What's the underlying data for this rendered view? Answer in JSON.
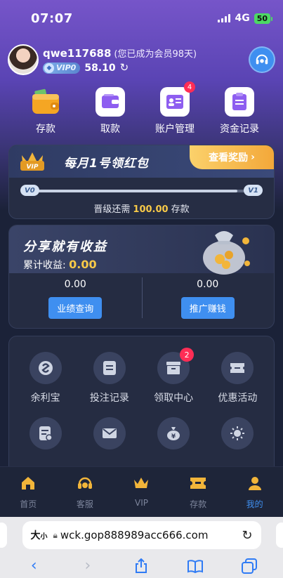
{
  "status_bar": {
    "time": "07:07",
    "network": "4G",
    "battery": "50"
  },
  "profile": {
    "username": "qwe117688",
    "member_note": "(您已成为会员98天)",
    "vip_level": "VIP0",
    "balance": "58.10"
  },
  "quick_actions": [
    {
      "label": "存款",
      "icon": "wallet-icon"
    },
    {
      "label": "取款",
      "icon": "withdraw-wallet-icon"
    },
    {
      "label": "账户管理",
      "icon": "id-card-icon",
      "badge": "4"
    },
    {
      "label": "资金记录",
      "icon": "records-icon"
    }
  ],
  "red_packet": {
    "title": "每月1号领红包",
    "cta": "查看奖励",
    "level_from": "V0",
    "level_to": "V1",
    "progress": 0.92,
    "upgrade_prefix": "晋级还需",
    "upgrade_amount": "100.00",
    "upgrade_suffix": "存款"
  },
  "share": {
    "title": "分享就有收益",
    "earnings_label": "累计收益:",
    "earnings_value": "0.00",
    "left_value": "0.00",
    "left_button": "业绩查询",
    "right_value": "0.00",
    "right_button": "推广赚钱"
  },
  "services": [
    {
      "label": "余利宝",
      "icon": "yulibao-icon"
    },
    {
      "label": "投注记录",
      "icon": "bet-record-icon"
    },
    {
      "label": "领取中心",
      "icon": "claim-center-icon",
      "badge": "2"
    },
    {
      "label": "优惠活动",
      "icon": "promotion-icon"
    },
    {
      "icon": "statement-icon"
    },
    {
      "icon": "mail-icon"
    },
    {
      "icon": "money-bag-icon"
    },
    {
      "icon": "settings-sun-icon"
    }
  ],
  "tabbar": [
    {
      "label": "首页",
      "icon": "home-icon"
    },
    {
      "label": "客服",
      "icon": "headset-icon"
    },
    {
      "label": "VIP",
      "icon": "crown-icon"
    },
    {
      "label": "存款",
      "icon": "ticket-icon"
    },
    {
      "label": "我的",
      "icon": "person-icon",
      "active": true
    }
  ],
  "browser": {
    "text_size_big": "大",
    "text_size_small": "小",
    "url": "wck.gop888989acc666.com"
  },
  "colors": {
    "accent_blue": "#3f8ff0",
    "gold": "#f7c948",
    "badge_red": "#ff2d55",
    "purple_header": "#7655c9"
  }
}
